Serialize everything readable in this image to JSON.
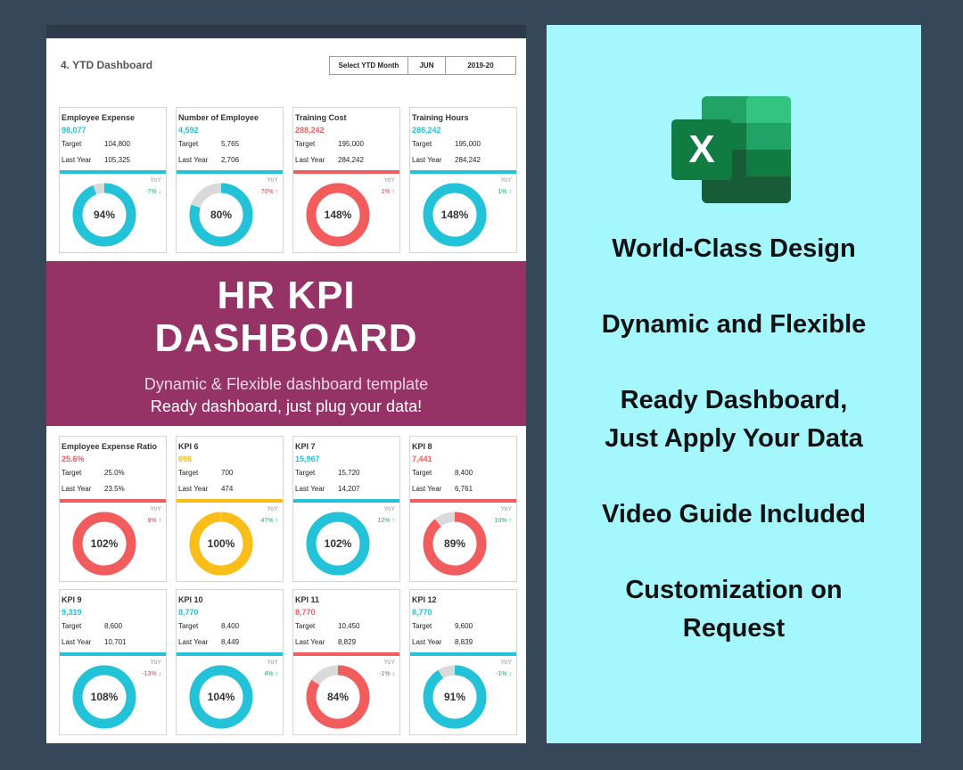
{
  "sheet": {
    "title": "4. YTD Dashboard",
    "selector": {
      "label": "Select YTD Month",
      "month": "JUN",
      "year": "2019-20"
    }
  },
  "colors": {
    "teal": "#22c3d9",
    "red": "#f25c5c",
    "yellow": "#fbbd17",
    "grey": "#d9d9d9",
    "green": "#1aa67a",
    "banner": "#953367"
  },
  "cards": [
    {
      "title": "Employee Expense",
      "value": "98,077",
      "value_color": "#22c3d9",
      "target_label": "Target",
      "target": "104,800",
      "ly_label": "Last Year",
      "last_year": "105,325",
      "bar_color": "#22c3d9",
      "yoy_label": "YoY",
      "yoy": "-7% ↓",
      "yoy_color": "#1aa67a",
      "pct_text": "94%",
      "fill": 0.94,
      "ring_color": "#22c3d9"
    },
    {
      "title": "Number of Employee",
      "value": "4,592",
      "value_color": "#22c3d9",
      "target_label": "Target",
      "target": "5,765",
      "ly_label": "Last Year",
      "last_year": "2,706",
      "bar_color": "#22c3d9",
      "yoy_label": "YoY",
      "yoy": "70% ↑",
      "yoy_color": "#e03b3b",
      "pct_text": "80%",
      "fill": 0.8,
      "ring_color": "#22c3d9"
    },
    {
      "title": "Training Cost",
      "value": "288,242",
      "value_color": "#f25c5c",
      "target_label": "Target",
      "target": "195,000",
      "ly_label": "Last Year",
      "last_year": "284,242",
      "bar_color": "#f25c5c",
      "yoy_label": "YoY",
      "yoy": "1% ↑",
      "yoy_color": "#e03b3b",
      "pct_text": "148%",
      "fill": 1.0,
      "ring_color": "#f25c5c"
    },
    {
      "title": "Training Hours",
      "value": "288,242",
      "value_color": "#22c3d9",
      "target_label": "Target",
      "target": "195,000",
      "ly_label": "Last Year",
      "last_year": "284,242",
      "bar_color": "#22c3d9",
      "yoy_label": "YoY",
      "yoy": "1% ↑",
      "yoy_color": "#1aa67a",
      "pct_text": "148%",
      "fill": 1.0,
      "ring_color": "#22c3d9"
    },
    {
      "title": "Employee Expense Ratio",
      "value": "25.6%",
      "value_color": "#f25c5c",
      "target_label": "Target",
      "target": "25.0%",
      "ly_label": "Last Year",
      "last_year": "23.5%",
      "bar_color": "#f25c5c",
      "yoy_label": "YoY",
      "yoy": "9% ↑",
      "yoy_color": "#e03b3b",
      "pct_text": "102%",
      "fill": 1.0,
      "ring_color": "#f25c5c"
    },
    {
      "title": "KPI 6",
      "value": "698",
      "value_color": "#fbbd17",
      "target_label": "Target",
      "target": "700",
      "ly_label": "Last Year",
      "last_year": "474",
      "bar_color": "#fbbd17",
      "yoy_label": "YoY",
      "yoy": "47% ↑",
      "yoy_color": "#1aa67a",
      "pct_text": "100%",
      "fill": 0.995,
      "ring_color": "#fbbd17"
    },
    {
      "title": "KPI 7",
      "value": "15,967",
      "value_color": "#22c3d9",
      "target_label": "Target",
      "target": "15,720",
      "ly_label": "Last Year",
      "last_year": "14,207",
      "bar_color": "#22c3d9",
      "yoy_label": "YoY",
      "yoy": "12% ↑",
      "yoy_color": "#1aa67a",
      "pct_text": "102%",
      "fill": 1.0,
      "ring_color": "#22c3d9"
    },
    {
      "title": "KPI 8",
      "value": "7,441",
      "value_color": "#f25c5c",
      "target_label": "Target",
      "target": "8,400",
      "ly_label": "Last Year",
      "last_year": "6,761",
      "bar_color": "#f25c5c",
      "yoy_label": "YoY",
      "yoy": "10% ↑",
      "yoy_color": "#1aa67a",
      "pct_text": "89%",
      "fill": 0.89,
      "ring_color": "#f25c5c"
    },
    {
      "title": "KPI 9",
      "value": "9,319",
      "value_color": "#22c3d9",
      "target_label": "Target",
      "target": "8,600",
      "ly_label": "Last Year",
      "last_year": "10,701",
      "bar_color": "#22c3d9",
      "yoy_label": "YoY",
      "yoy": "-13% ↓",
      "yoy_color": "#e03b3b",
      "pct_text": "108%",
      "fill": 1.0,
      "ring_color": "#22c3d9"
    },
    {
      "title": "KPI 10",
      "value": "8,770",
      "value_color": "#22c3d9",
      "target_label": "Target",
      "target": "8,400",
      "ly_label": "Last Year",
      "last_year": "8,449",
      "bar_color": "#22c3d9",
      "yoy_label": "YoY",
      "yoy": "4% ↑",
      "yoy_color": "#1aa67a",
      "pct_text": "104%",
      "fill": 1.0,
      "ring_color": "#22c3d9"
    },
    {
      "title": "KPI 11",
      "value": "8,770",
      "value_color": "#f25c5c",
      "target_label": "Target",
      "target": "10,450",
      "ly_label": "Last Year",
      "last_year": "8,829",
      "bar_color": "#f25c5c",
      "yoy_label": "YoY",
      "yoy": "-1% ↓",
      "yoy_color": "#e03b3b",
      "pct_text": "84%",
      "fill": 0.84,
      "ring_color": "#f25c5c"
    },
    {
      "title": "KPI 12",
      "value": "8,770",
      "value_color": "#22c3d9",
      "target_label": "Target",
      "target": "9,600",
      "ly_label": "Last Year",
      "last_year": "8,839",
      "bar_color": "#22c3d9",
      "yoy_label": "YoY",
      "yoy": "-1% ↓",
      "yoy_color": "#1aa67a",
      "pct_text": "91%",
      "fill": 0.91,
      "ring_color": "#22c3d9"
    }
  ],
  "banner": {
    "title_line1": "HR KPI",
    "title_line2": "DASHBOARD",
    "subtitle_line1": "Dynamic & Flexible dashboard template",
    "subtitle_line2": "Ready dashboard, just plug your data!"
  },
  "panel": {
    "logo_letter": "X",
    "features": [
      "World-Class Design",
      "Dynamic and Flexible",
      "Ready Dashboard,",
      "Just Apply Your Data",
      "Video Guide Included",
      "Customization on",
      "Request"
    ]
  }
}
